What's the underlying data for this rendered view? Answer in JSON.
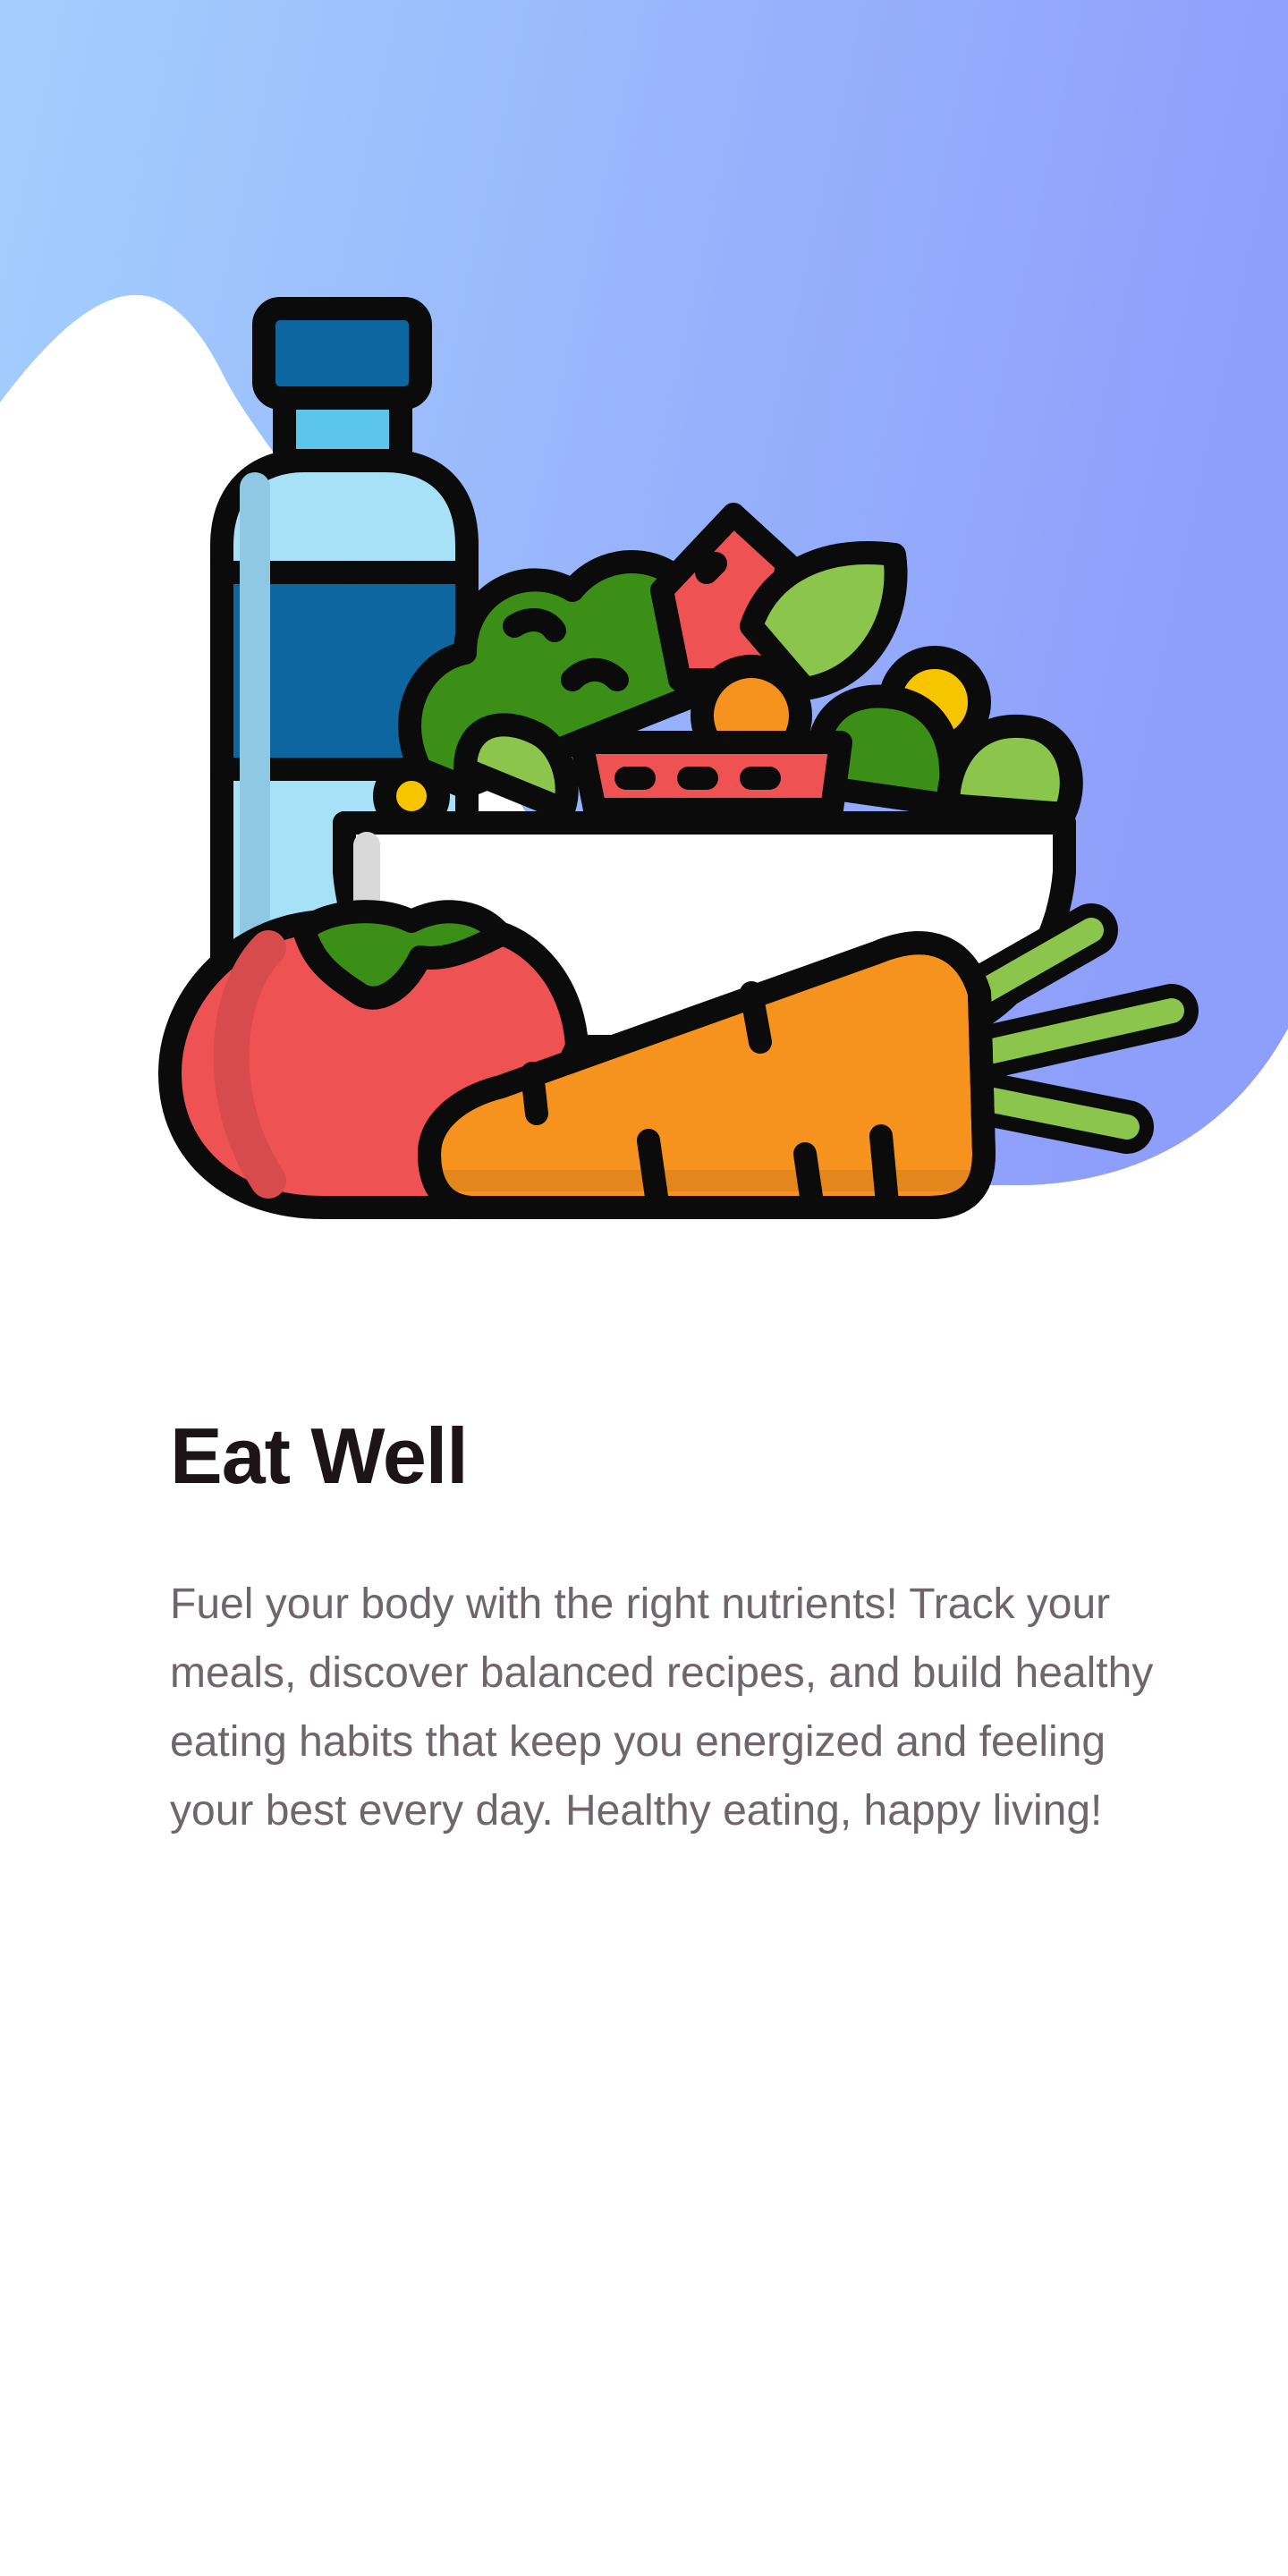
{
  "colors": {
    "gradient_start": "#A4CFFD",
    "gradient_end": "#8E9EFB",
    "title": "#1C1416",
    "body_text": "#6F666C",
    "background": "#FFFFFF"
  },
  "hero": {
    "illustration": "healthy-food-illustration"
  },
  "onboarding": {
    "title": "Eat Well",
    "description": "Fuel your body with the right nutrients! Track your meals, discover balanced recipes, and build healthy eating habits that keep you energized and feeling your best every day. Healthy eating, happy living!"
  }
}
